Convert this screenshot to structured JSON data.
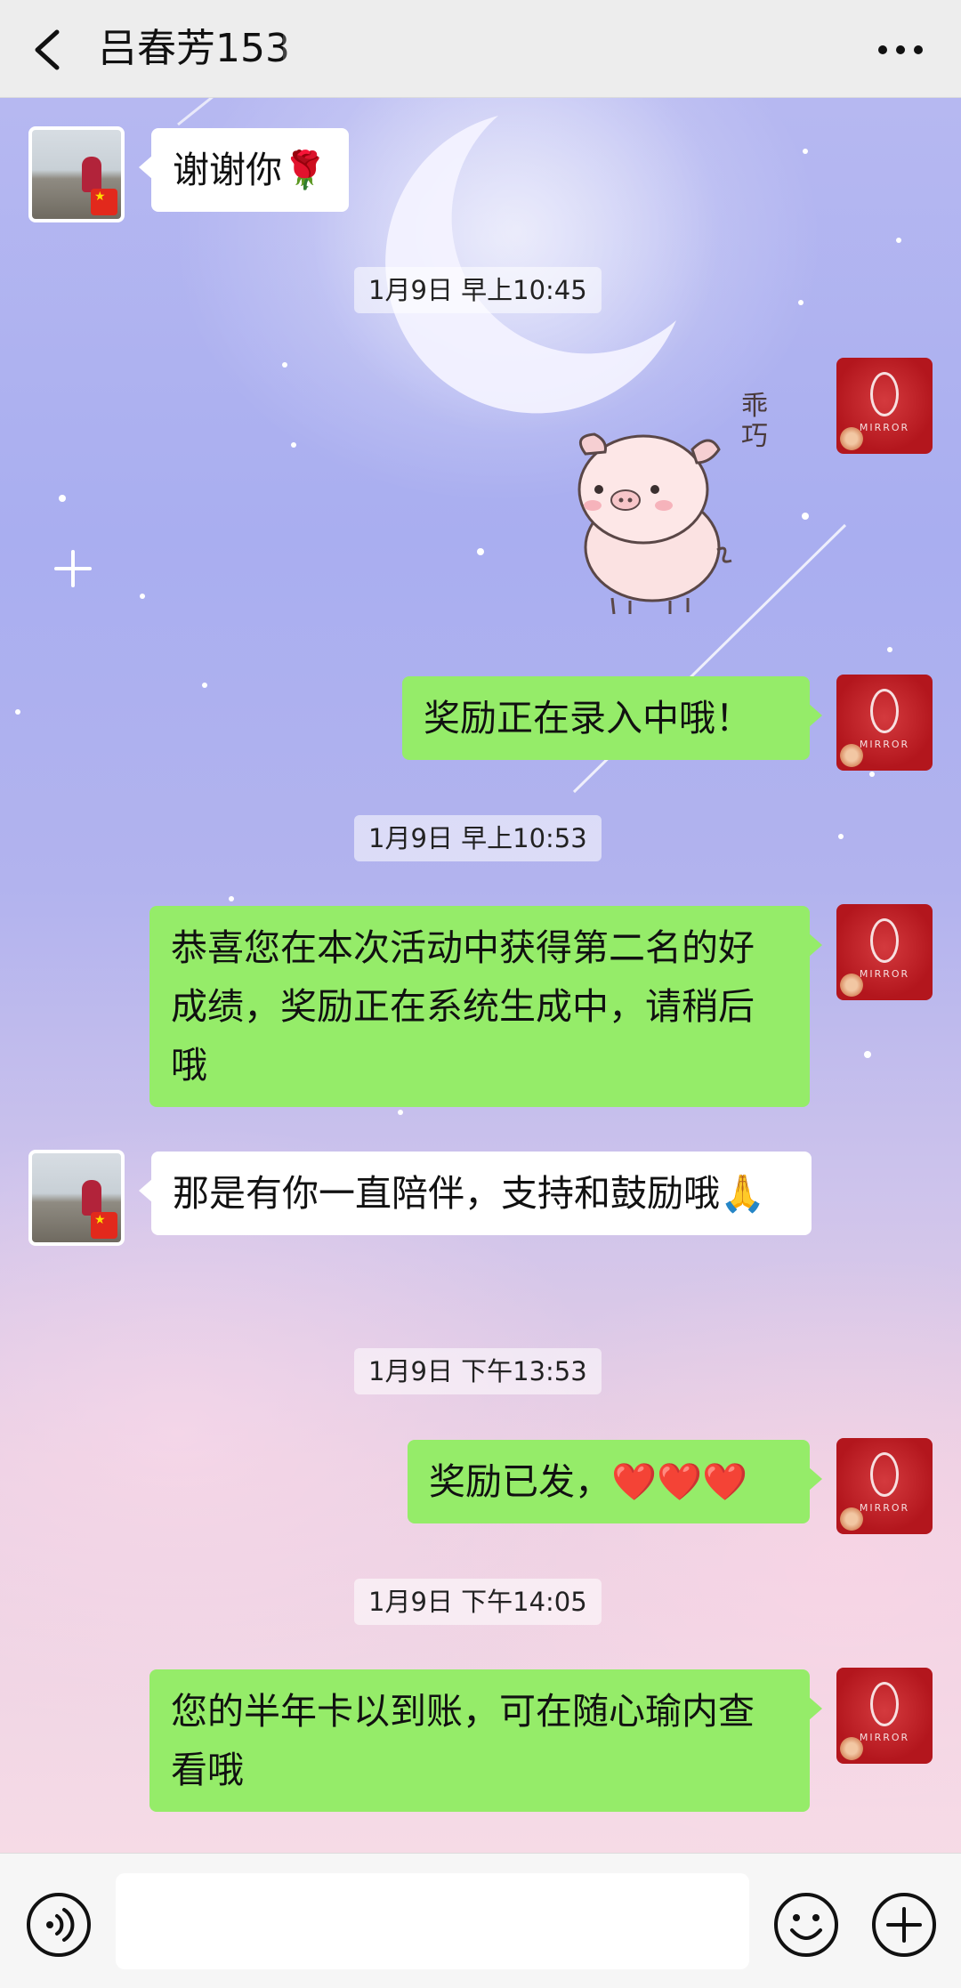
{
  "header": {
    "title": "吕春芳153",
    "back_icon": "chevron-left-icon",
    "more_icon": "more-dots-icon"
  },
  "messages": [
    {
      "id": "m1",
      "side": "in",
      "text": "谢谢你🌹"
    },
    {
      "id": "t1",
      "type": "time",
      "text": "1月9日 早上10:45"
    },
    {
      "id": "m2",
      "side": "out",
      "type": "sticker",
      "text": "乖巧"
    },
    {
      "id": "m3",
      "side": "out",
      "text": "奖励正在录入中哦！"
    },
    {
      "id": "t2",
      "type": "time",
      "text": "1月9日 早上10:53"
    },
    {
      "id": "m4",
      "side": "out",
      "text": "恭喜您在本次活动中获得第二名的好成绩，奖励正在系统生成中，请稍后哦"
    },
    {
      "id": "m5",
      "side": "in",
      "text": "那是有你一直陪伴，支持和鼓励哦🙏"
    },
    {
      "id": "t3",
      "type": "time",
      "text": "1月9日 下午13:53"
    },
    {
      "id": "m6",
      "side": "out",
      "text": "奖励已发，❤️❤️❤️"
    },
    {
      "id": "t4",
      "type": "time",
      "text": "1月9日 下午14:05"
    },
    {
      "id": "m7",
      "side": "out",
      "text": "您的半年卡以到账，可在随心瑜内查看哦"
    }
  ],
  "avatar_right": {
    "brand": "MIRROR"
  },
  "input_bar": {
    "voice_icon": "voice-icon",
    "placeholder": "",
    "emoji_icon": "emoji-icon",
    "plus_icon": "plus-icon"
  },
  "colors": {
    "out_bubble": "#95ec69",
    "in_bubble": "#ffffff",
    "header_bg": "#ededed"
  }
}
